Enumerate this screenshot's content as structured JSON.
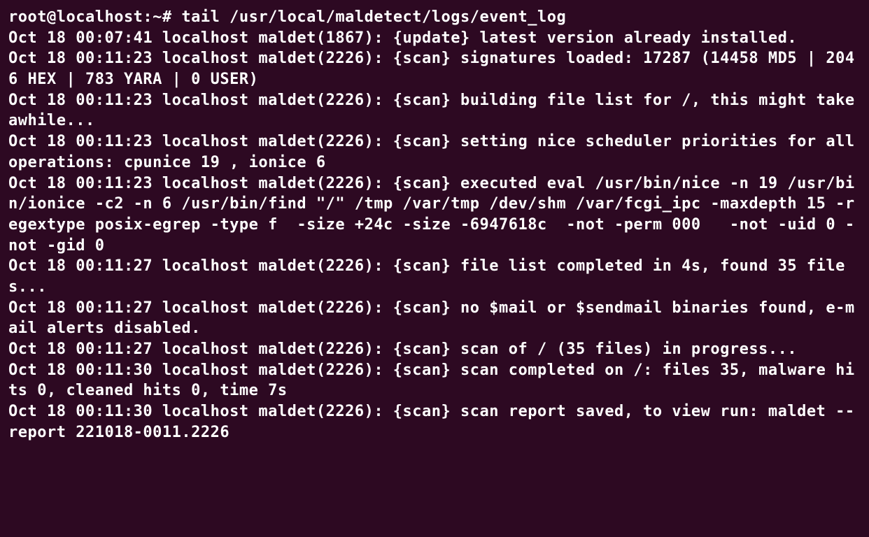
{
  "terminal": {
    "prompt": "root@localhost:~# ",
    "command": "tail /usr/local/maldetect/logs/event_log",
    "lines": [
      "Oct 18 00:07:41 localhost maldet(1867): {update} latest version already installed.",
      "Oct 18 00:11:23 localhost maldet(2226): {scan} signatures loaded: 17287 (14458 MD5 | 2046 HEX | 783 YARA | 0 USER)",
      "Oct 18 00:11:23 localhost maldet(2226): {scan} building file list for /, this might take awhile...",
      "Oct 18 00:11:23 localhost maldet(2226): {scan} setting nice scheduler priorities for all operations: cpunice 19 , ionice 6",
      "Oct 18 00:11:23 localhost maldet(2226): {scan} executed eval /usr/bin/nice -n 19 /usr/bin/ionice -c2 -n 6 /usr/bin/find \"/\" /tmp /var/tmp /dev/shm /var/fcgi_ipc -maxdepth 15 -regextype posix-egrep -type f  -size +24c -size -6947618c  -not -perm 000   -not -uid 0 -not -gid 0",
      "Oct 18 00:11:27 localhost maldet(2226): {scan} file list completed in 4s, found 35 files...",
      "Oct 18 00:11:27 localhost maldet(2226): {scan} no $mail or $sendmail binaries found, e-mail alerts disabled.",
      "Oct 18 00:11:27 localhost maldet(2226): {scan} scan of / (35 files) in progress...",
      "Oct 18 00:11:30 localhost maldet(2226): {scan} scan completed on /: files 35, malware hits 0, cleaned hits 0, time 7s",
      "Oct 18 00:11:30 localhost maldet(2226): {scan} scan report saved, to view run: maldet --report 221018-0011.2226"
    ]
  }
}
